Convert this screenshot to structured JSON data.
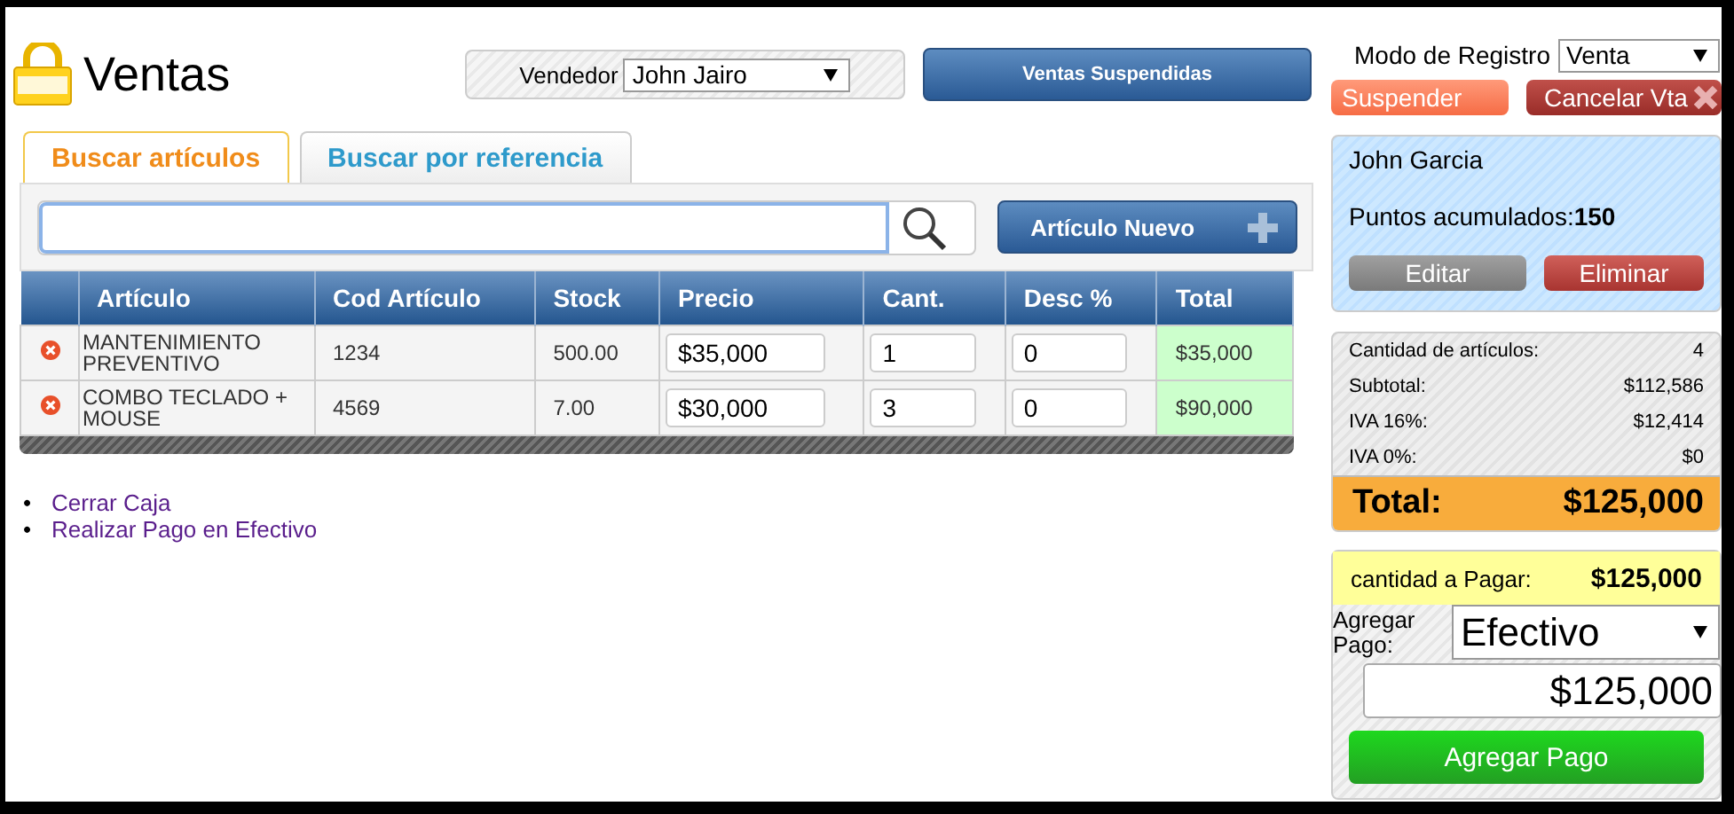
{
  "title": "Ventas",
  "vendedor": {
    "label": "Vendedor",
    "value": "John Jairo"
  },
  "suspended_button": "Ventas Suspendidas",
  "tabs": [
    {
      "label": "Buscar artículos",
      "selected": true
    },
    {
      "label": "Buscar por referencia",
      "selected": false
    }
  ],
  "new_item_button": "Artículo Nuevo",
  "table": {
    "columns": [
      "Artículo",
      "Cod Artículo",
      "Stock",
      "Precio",
      "Cant.",
      "Desc %",
      "Total"
    ],
    "rows": [
      {
        "articulo": "MANTENIMIENTO PREVENTIVO",
        "codigo": "1234",
        "stock": "500.00",
        "precio": "$35,000",
        "cant": "1",
        "desc": "0",
        "total": "$35,000"
      },
      {
        "articulo": "COMBO TECLADO + MOUSE",
        "codigo": "4569",
        "stock": "7.00",
        "precio": "$30,000",
        "cant": "3",
        "desc": "0",
        "total": "$90,000"
      }
    ]
  },
  "links": [
    {
      "bullet": "•",
      "label": "Cerrar Caja"
    },
    {
      "bullet": "•",
      "label": "Realizar Pago en Efectivo"
    }
  ],
  "modo": {
    "label": "Modo de Registro",
    "value": "Venta"
  },
  "suspend_button": "Suspender",
  "cancel_button": "Cancelar Vta",
  "customer": {
    "name": "John Garcia",
    "points_label": "Puntos acumulados:",
    "points": "150",
    "edit_button": "Editar",
    "delete_button": "Eliminar"
  },
  "summary": [
    {
      "label": "Cantidad de artículos:",
      "value": "4"
    },
    {
      "label": "Subtotal:",
      "value": "$112,586"
    },
    {
      "label": "IVA 16%:",
      "value": "$12,414"
    },
    {
      "label": "IVA 0%:",
      "value": "$0"
    }
  ],
  "total": {
    "label": "Total:",
    "value": "$125,000"
  },
  "payment": {
    "due_label": "cantidad a Pagar:",
    "due_value": "$125,000",
    "add_label": "Agregar Pago:",
    "method": "Efectivo",
    "amount": "$125,000",
    "button": "Agregar Pago"
  }
}
